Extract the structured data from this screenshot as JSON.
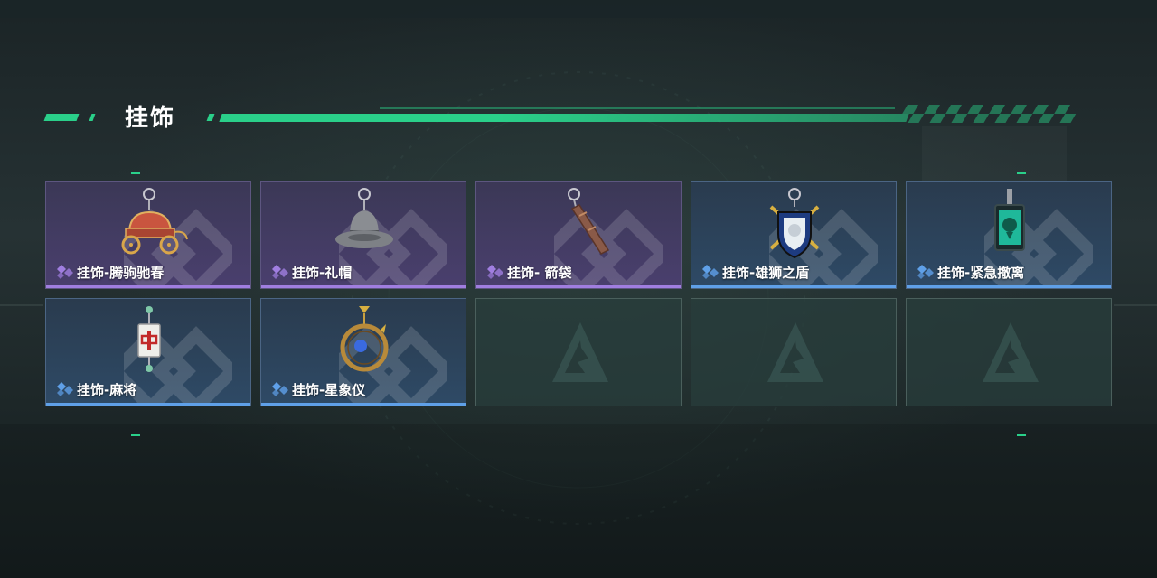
{
  "section": {
    "title": "挂饰"
  },
  "colors": {
    "accent": "#2ad08a",
    "purple_rarity": "#a07ee0",
    "blue_rarity": "#5fa0e8"
  },
  "items": [
    {
      "name": "挂饰-腾驹驰春",
      "rarity": "purple",
      "icon": "carriage-charm-icon"
    },
    {
      "name": "挂饰-礼帽",
      "rarity": "purple",
      "icon": "fedora-hat-charm-icon"
    },
    {
      "name": "挂饰- 箭袋",
      "rarity": "purple",
      "icon": "quiver-charm-icon"
    },
    {
      "name": "挂饰-雄狮之盾",
      "rarity": "blue",
      "icon": "lion-shield-charm-icon"
    },
    {
      "name": "挂饰-紧急撤离",
      "rarity": "blue",
      "icon": "emergency-evac-charm-icon"
    },
    {
      "name": "挂饰-麻将",
      "rarity": "blue",
      "icon": "mahjong-tile-charm-icon"
    },
    {
      "name": "挂饰-星象仪",
      "rarity": "blue",
      "icon": "astrolabe-charm-icon"
    }
  ],
  "empty_slots": 3
}
